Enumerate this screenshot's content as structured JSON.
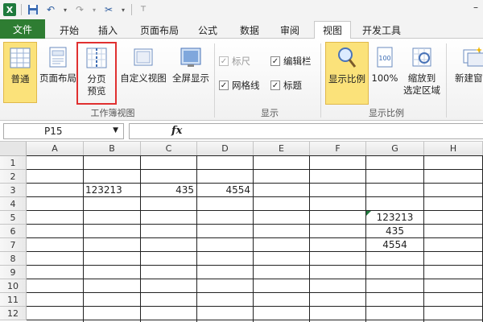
{
  "window": {
    "minimize_label": "–"
  },
  "tabs": {
    "file": "文件",
    "home": "开始",
    "insert": "插入",
    "page_layout": "页面布局",
    "formulas": "公式",
    "data": "数据",
    "review": "审阅",
    "view": "视图",
    "developer": "开发工具",
    "active": "view"
  },
  "ribbon": {
    "workbook_views": {
      "group_label": "工作簿视图",
      "normal": "普通",
      "page_layout": "页面布局",
      "page_break_preview_line1": "分页",
      "page_break_preview_line2": "预览",
      "custom_views": "自定义视图",
      "full_screen": "全屏显示"
    },
    "show": {
      "group_label": "显示",
      "ruler": "标尺",
      "ruler_checked": true,
      "ruler_enabled": false,
      "formula_bar": "编辑栏",
      "formula_bar_checked": true,
      "gridlines": "网格线",
      "gridlines_checked": true,
      "headings": "标题",
      "headings_checked": true
    },
    "zoom": {
      "group_label": "显示比例",
      "zoom": "显示比例",
      "hundred": "100%",
      "zoom_to_selection_line1": "缩放到",
      "zoom_to_selection_line2": "选定区域"
    },
    "window": {
      "new_window": "新建窗口"
    },
    "highlight_color": "#e03030",
    "active_button_color": "#fbe27a"
  },
  "formula_bar": {
    "name_box_value": "P15",
    "fx_label": "fx",
    "formula_value": ""
  },
  "sheet": {
    "columns": [
      "A",
      "B",
      "C",
      "D",
      "E",
      "F",
      "G",
      "H"
    ],
    "rows": [
      "1",
      "2",
      "3",
      "4",
      "5",
      "6",
      "7",
      "8",
      "9",
      "10",
      "11",
      "12"
    ],
    "cells": {
      "B3": "123213",
      "C3": "435",
      "D3": "4554",
      "G5": "123213",
      "G6": "435",
      "G7": "4554"
    }
  }
}
